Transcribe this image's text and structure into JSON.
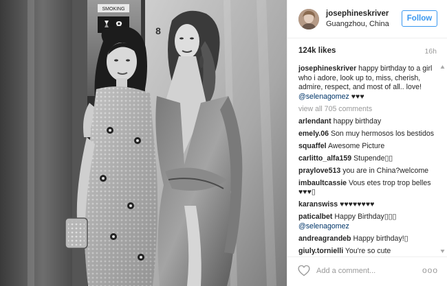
{
  "post": {
    "username": "josephineskriver",
    "location": "Guangzhou, China",
    "follow_label": "Follow",
    "likes": "124k likes",
    "time": "16h",
    "photo": {
      "elevator_floor_sign": "8",
      "elevator_sign_text": "SMOKING"
    },
    "caption": {
      "user": "josephineskriver",
      "text": "happy birthday to a girl who i adore, look up to, miss, cherish, admire, respect, and most of all.. love!",
      "mention": "@selenagomez",
      "suffix": "♥♥♥"
    },
    "view_all": "view all 705 comments",
    "comments": [
      {
        "user": "arlendant",
        "text": "happy birthday",
        "mention": ""
      },
      {
        "user": "emely.06",
        "text": "Son muy hermosos los bestidos",
        "mention": ""
      },
      {
        "user": "squaffel",
        "text": "Awesome Picture",
        "mention": ""
      },
      {
        "user": "carlitto_alfa159",
        "text": "Stupende▯▯",
        "mention": ""
      },
      {
        "user": "praylove513",
        "text": "you are in China?welcome",
        "mention": ""
      },
      {
        "user": "imbaultcassie",
        "text": "Vous etes trop trop belles ♥♥♥▯",
        "mention": ""
      },
      {
        "user": "karanswiss",
        "text": "♥♥♥♥♥♥♥♥",
        "mention": ""
      },
      {
        "user": "paticalbet",
        "text": "Happy Birthday▯▯▯",
        "mention": "@selenagomez"
      },
      {
        "user": "andreagrandeb",
        "text": "Happy birthday!▯",
        "mention": ""
      },
      {
        "user": "giuly.tornielli",
        "text": "You're so cute",
        "mention": ""
      }
    ],
    "add_comment_placeholder": "Add a comment...",
    "more_label": "ooo"
  }
}
